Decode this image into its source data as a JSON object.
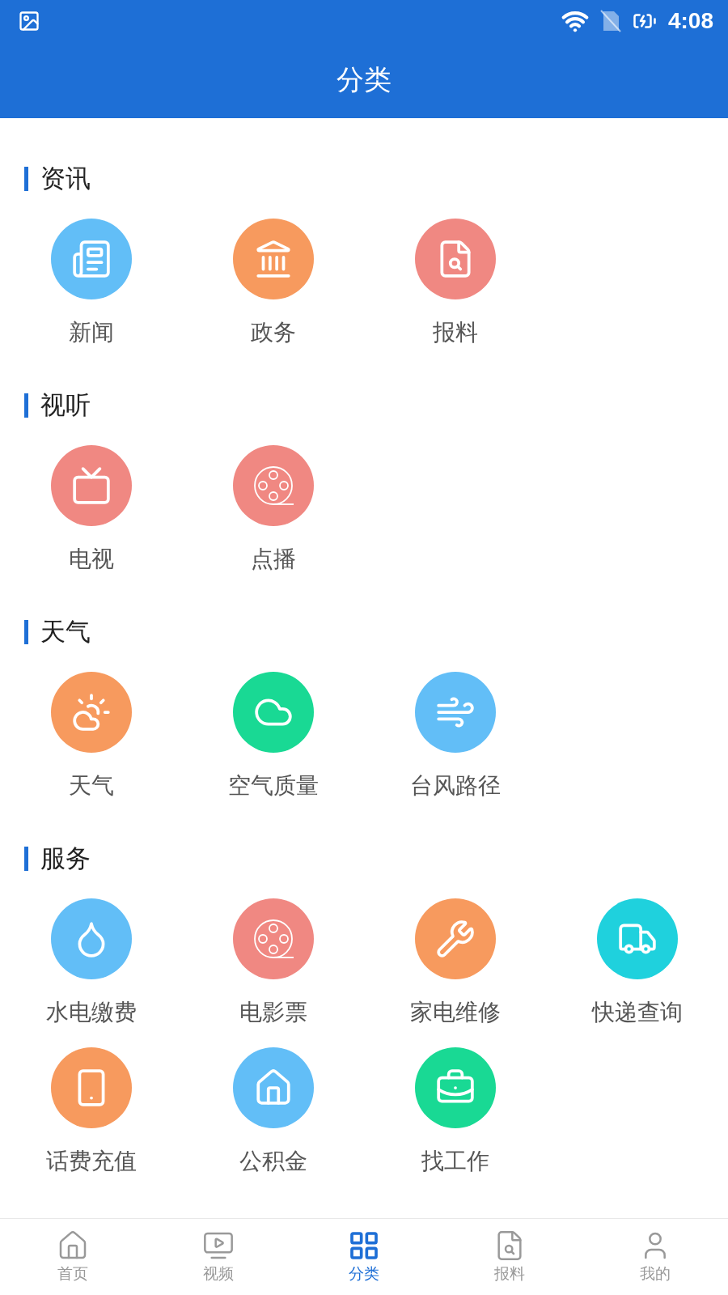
{
  "status_bar": {
    "time": "4:08"
  },
  "header": {
    "title": "分类"
  },
  "sections": [
    {
      "title": "资讯",
      "items": [
        {
          "label": "新闻",
          "color": "#62bef7"
        },
        {
          "label": "政务",
          "color": "#f79a5e"
        },
        {
          "label": "报料",
          "color": "#f08882"
        }
      ]
    },
    {
      "title": "视听",
      "items": [
        {
          "label": "电视",
          "color": "#f08882"
        },
        {
          "label": "点播",
          "color": "#f08882"
        }
      ]
    },
    {
      "title": "天气",
      "items": [
        {
          "label": "天气",
          "color": "#f79a5e"
        },
        {
          "label": "空气质量",
          "color": "#19d994"
        },
        {
          "label": "台风路径",
          "color": "#62bef7"
        }
      ]
    },
    {
      "title": "服务",
      "items": [
        {
          "label": "水电缴费",
          "color": "#62bef7"
        },
        {
          "label": "电影票",
          "color": "#f08882"
        },
        {
          "label": "家电维修",
          "color": "#f79a5e"
        },
        {
          "label": "快递查询",
          "color": "#1fd1dd"
        },
        {
          "label": "话费充值",
          "color": "#f79a5e"
        },
        {
          "label": "公积金",
          "color": "#62bef7"
        },
        {
          "label": "找工作",
          "color": "#19d994"
        }
      ]
    }
  ],
  "tab_bar": [
    {
      "label": "首页",
      "selected": false
    },
    {
      "label": "视频",
      "selected": false
    },
    {
      "label": "分类",
      "selected": true
    },
    {
      "label": "报料",
      "selected": false
    },
    {
      "label": "我的",
      "selected": false
    }
  ]
}
